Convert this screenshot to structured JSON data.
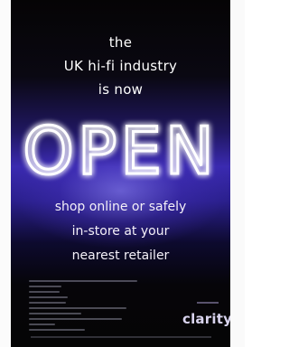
{
  "headline": {
    "line1": "the",
    "line2": "UK hi-fi industry",
    "line3": "is now"
  },
  "sign": {
    "word": "OPEN",
    "glow_color": "#ffffff",
    "background_accent": "#3a2ab0"
  },
  "tagline": {
    "line1": "shop online or safely",
    "line2": "in-store at your",
    "line3": "nearest retailer"
  },
  "brand": {
    "name": "clarity"
  }
}
